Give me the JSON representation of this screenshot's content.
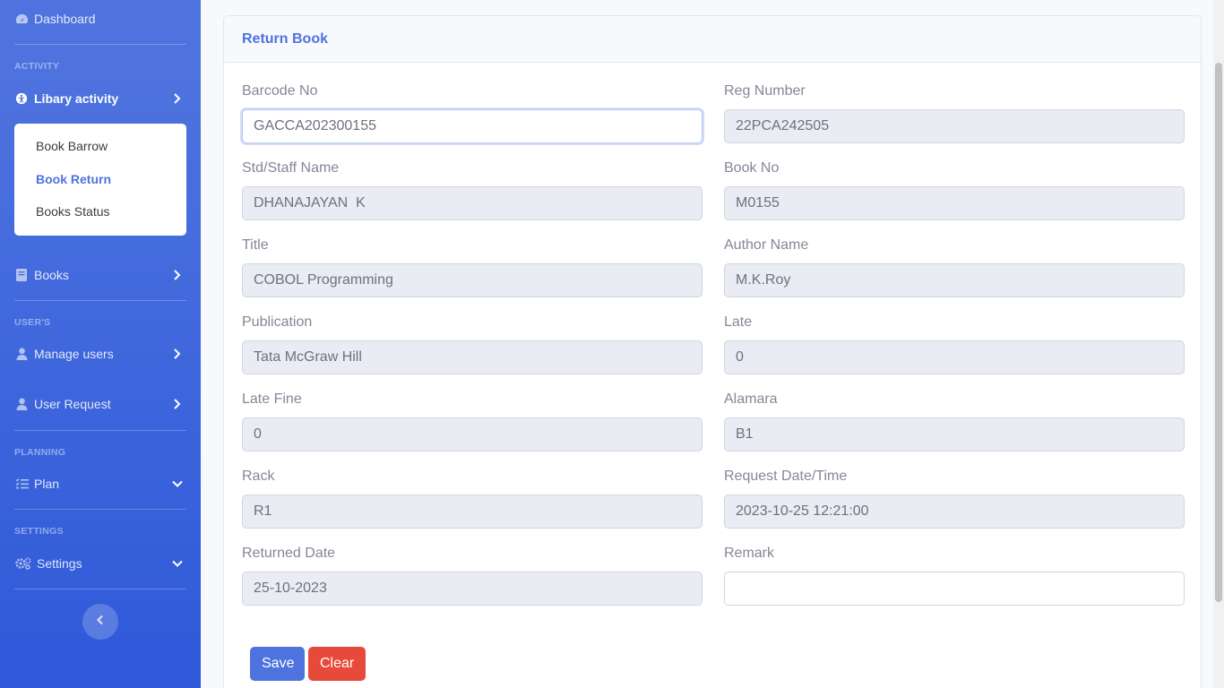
{
  "sidebar": {
    "dashboard": "Dashboard",
    "heading_activity": "ACTIVITY",
    "libary_activity": "Libary activity",
    "sub_items": [
      "Book Barrow",
      "Book Return",
      "Books Status"
    ],
    "books": "Books",
    "heading_users": "USER'S",
    "manage_users": "Manage users",
    "user_request": "User Request",
    "heading_planning": "PLANNING",
    "plan": "Plan",
    "heading_settings": "SETTINGS",
    "settings": "Settings"
  },
  "card": {
    "title": "Return Book"
  },
  "form": {
    "barcode_label": "Barcode No",
    "barcode_value": "GACCA202300155",
    "reg_label": "Reg Number",
    "reg_value": "22PCA242505",
    "name_label": "Std/Staff Name",
    "name_value": "DHANAJAYAN  K",
    "bookno_label": "Book No",
    "bookno_value": "M0155",
    "title_label": "Title",
    "title_value": "COBOL Programming",
    "author_label": "Author Name",
    "author_value": "M.K.Roy",
    "publication_label": "Publication",
    "publication_value": "Tata McGraw Hill",
    "late_label": "Late",
    "late_value": "0",
    "latefine_label": "Late Fine",
    "latefine_value": "0",
    "alamara_label": "Alamara",
    "alamara_value": "B1",
    "rack_label": "Rack",
    "rack_value": "R1",
    "reqdate_label": "Request Date/Time",
    "reqdate_value": "2023-10-25 12:21:00",
    "returned_label": "Returned Date",
    "returned_value": "25-10-2023",
    "remark_label": "Remark",
    "remark_value": ""
  },
  "buttons": {
    "save": "Save",
    "clear": "Clear"
  },
  "colors": {
    "primary": "#4e73df",
    "danger": "#e74a3b"
  }
}
